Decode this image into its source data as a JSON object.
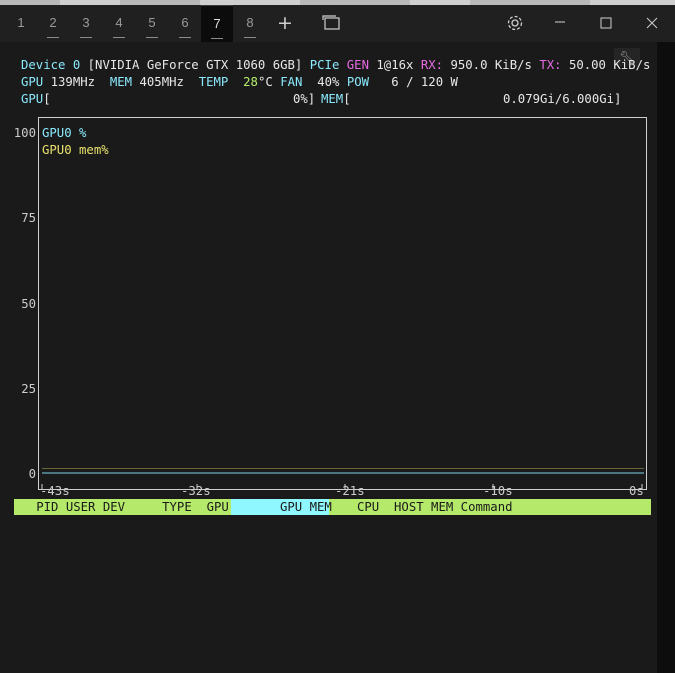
{
  "window": {
    "tabs": [
      {
        "label": "1",
        "active": false
      },
      {
        "label": "2",
        "active": false
      },
      {
        "label": "3",
        "active": false
      },
      {
        "label": "4",
        "active": false
      },
      {
        "label": "5",
        "active": false
      },
      {
        "label": "6",
        "active": false
      },
      {
        "label": "7",
        "active": true
      },
      {
        "label": "8",
        "active": false
      }
    ],
    "new_tab_glyph": "+",
    "icons": [
      "new-tab-icon",
      "tab-overview-icon",
      "settings-icon",
      "minimize-icon",
      "maximize-icon",
      "close-icon"
    ]
  },
  "device": {
    "label": "Device 0",
    "name": "[NVIDIA GeForce GTX 1060 6GB]",
    "pcie_label": "PCIe",
    "gen_label": "GEN",
    "gen_value": "1@16x",
    "rx_label": "RX:",
    "rx_value": "950.0 KiB/s",
    "tx_label": "TX:",
    "tx_value": "50.00 KiB/s"
  },
  "stats": {
    "gpu_label": "GPU",
    "gpu_clock": "139MHz",
    "mem_label": "MEM",
    "mem_clock": "405MHz",
    "temp_label": "TEMP",
    "temp_value": "28",
    "temp_unit": "°C",
    "fan_label": "FAN",
    "fan_value": "40%",
    "pow_label": "POW",
    "pow_value": "6 / 120 W"
  },
  "bars": {
    "gpu_label": "GPU",
    "gpu_open": "[",
    "gpu_pct": "0%]",
    "mem_label": "MEM",
    "mem_open": "[",
    "mem_value": "0.079Gi/6.000Gi]",
    "gpu_util": 0,
    "mem_util": 0.013
  },
  "chart_data": {
    "type": "line",
    "series": [
      {
        "name": "GPU0 %",
        "values": [
          0,
          0,
          0,
          0,
          0
        ]
      },
      {
        "name": "GPU0 mem%",
        "values": [
          1.3,
          1.3,
          1.3,
          1.3,
          1.3
        ]
      }
    ],
    "x": [
      "-43s",
      "-32s",
      "-21s",
      "-10s",
      "0s"
    ],
    "yticks": [
      "100",
      "75",
      "50",
      "25",
      "0"
    ],
    "ylim": [
      0,
      100
    ],
    "colors": {
      "gpu": "#8be9fd",
      "mem": "#e9e36b"
    }
  },
  "process_header": {
    "pid": "PID",
    "user": "USER",
    "dev": "DEV",
    "type": "TYPE",
    "gpu": "GPU",
    "gpu_mem": "GPU MEM",
    "cpu": "CPU",
    "host_mem": "HOST MEM",
    "command": "Command"
  }
}
